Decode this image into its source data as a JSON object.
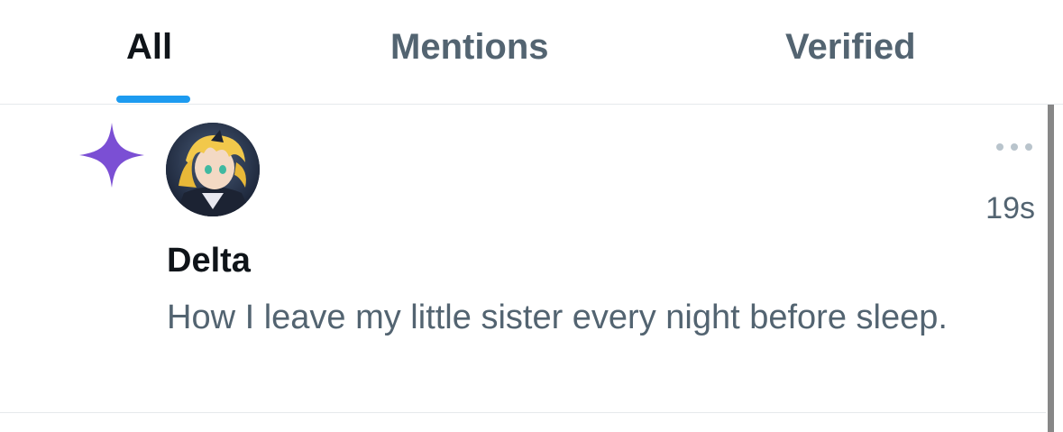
{
  "tabs": [
    {
      "label": "All",
      "active": true
    },
    {
      "label": "Mentions",
      "active": false
    },
    {
      "label": "Verified",
      "active": false
    }
  ],
  "colors": {
    "accent": "#1d9bf0",
    "spark": "#7b4fd4",
    "text_primary": "#0f1419",
    "text_secondary": "#536471"
  },
  "notification": {
    "icon": "sparkle-icon",
    "user_name": "Delta",
    "timestamp": "19s",
    "text": "How I leave my little sister every night before sleep.",
    "more_icon": "more-horizontal-icon"
  }
}
